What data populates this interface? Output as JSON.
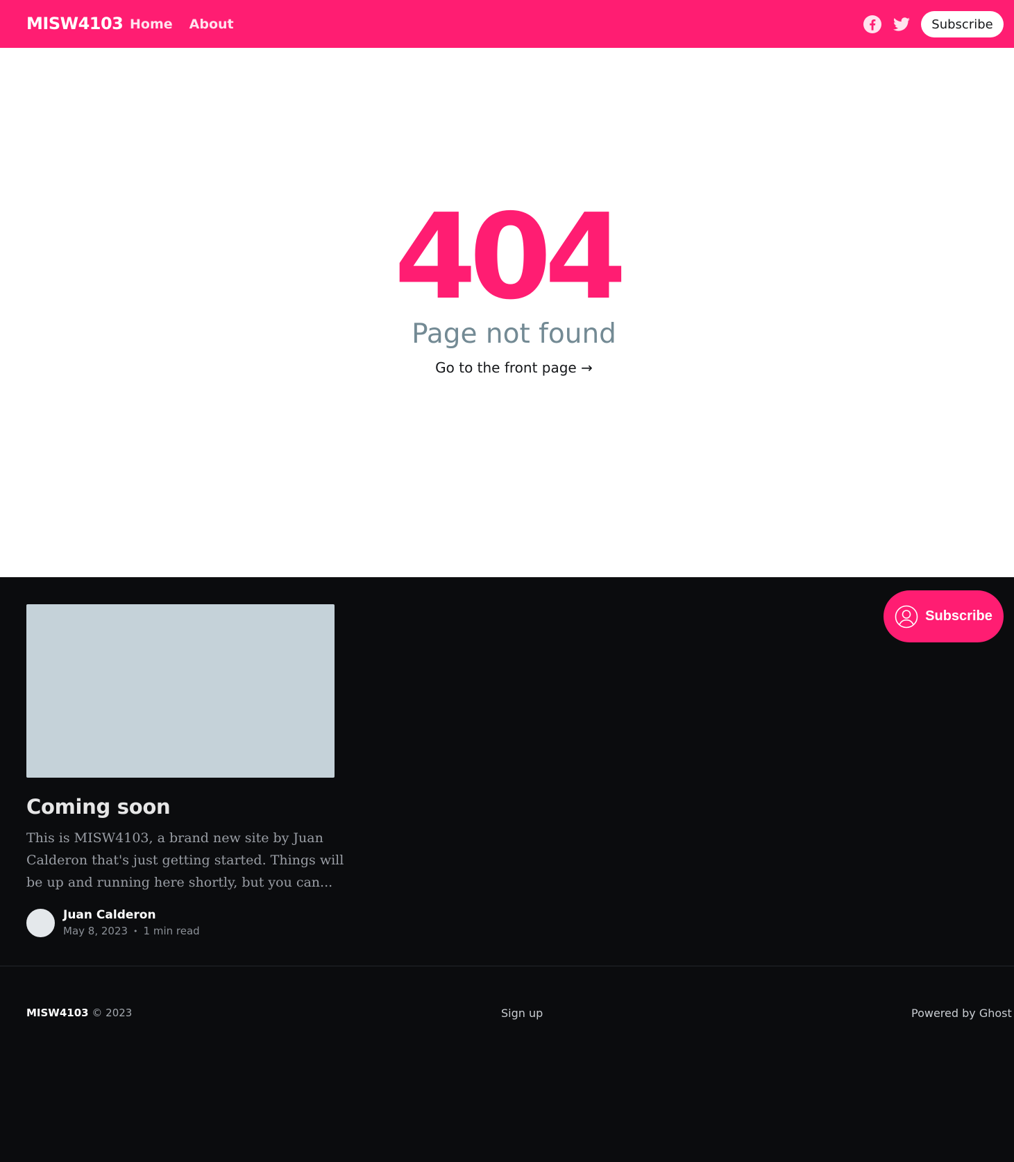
{
  "header": {
    "brand": "MISW4103",
    "nav": [
      {
        "label": "Home"
      },
      {
        "label": "About"
      }
    ],
    "social": [
      {
        "icon": "facebook-icon"
      },
      {
        "icon": "twitter-icon"
      }
    ],
    "subscribe_label": "Subscribe",
    "accent_color": "#ff1d72"
  },
  "error": {
    "code": "404",
    "message": "Page not found",
    "link_label": "Go to the front page →"
  },
  "post": {
    "title": "Coming soon",
    "excerpt": "This is MISW4103, a brand new site by Juan Calderon that's just getting started. Things will be up and running here shortly, but you can...",
    "author": "Juan Calderon",
    "date": "May 8, 2023",
    "separator": "•",
    "read_time": "1 min read"
  },
  "floating_subscribe": {
    "label": "Subscribe",
    "icon": "user-circle-icon"
  },
  "footer": {
    "brand": "MISW4103",
    "copyright": "© 2023",
    "signup_label": "Sign up",
    "powered_label": "Powered by Ghost"
  }
}
